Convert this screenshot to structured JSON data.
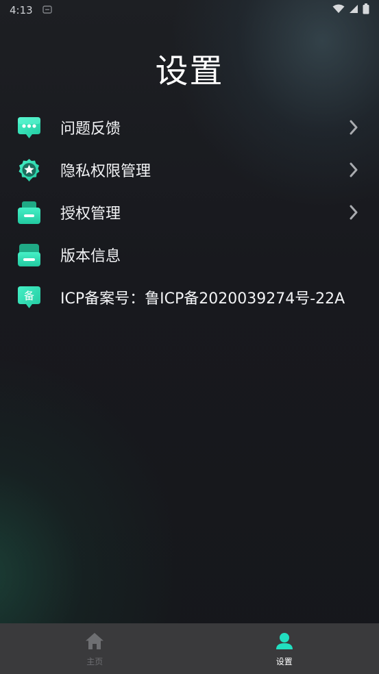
{
  "status_bar": {
    "time": "4:13"
  },
  "page": {
    "title": "设置"
  },
  "menu": {
    "items": [
      {
        "label": "问题反馈",
        "icon": "chat-bubble-icon",
        "has_chevron": true
      },
      {
        "label": "隐私权限管理",
        "icon": "star-badge-icon",
        "has_chevron": true
      },
      {
        "label": "授权管理",
        "icon": "drawer-icon",
        "has_chevron": true
      },
      {
        "label": "版本信息",
        "icon": "version-drawer-icon",
        "has_chevron": false
      },
      {
        "label": "ICP备案号：鲁ICP备2020039274号-22A",
        "icon": "icp-badge-icon",
        "icon_text": "备",
        "has_chevron": false
      }
    ]
  },
  "tabbar": {
    "tabs": [
      {
        "label": "主页",
        "icon": "home-icon",
        "active": false
      },
      {
        "label": "设置",
        "icon": "user-icon",
        "active": true
      }
    ]
  },
  "colors": {
    "accent": "#2de0b5",
    "background": "#16171c",
    "tabbar": "#3a3a3c"
  }
}
